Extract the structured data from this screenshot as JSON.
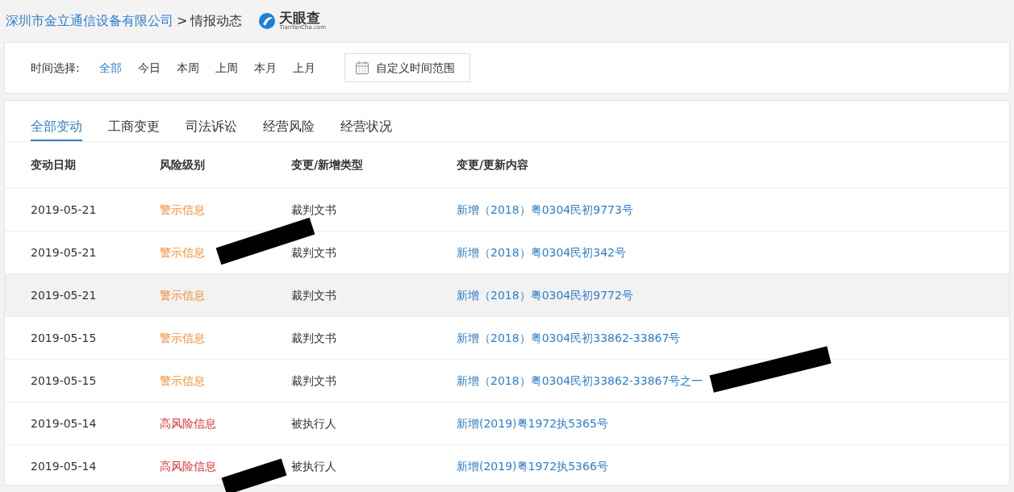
{
  "breadcrumb": {
    "company": "深圳市金立通信设备有限公司",
    "separator": ">",
    "page": "情报动态"
  },
  "logo": {
    "name": "天眼查",
    "domain": "TianYanCha.com"
  },
  "time_filter": {
    "label": "时间选择:",
    "options": [
      {
        "label": "全部",
        "selected": true
      },
      {
        "label": "今日",
        "selected": false
      },
      {
        "label": "本周",
        "selected": false
      },
      {
        "label": "上周",
        "selected": false
      },
      {
        "label": "本月",
        "selected": false
      },
      {
        "label": "上月",
        "selected": false
      }
    ],
    "custom_button": "自定义时间范围"
  },
  "tabs": [
    {
      "label": "全部变动",
      "selected": true
    },
    {
      "label": "工商变更",
      "selected": false
    },
    {
      "label": "司法诉讼",
      "selected": false
    },
    {
      "label": "经营风险",
      "selected": false
    },
    {
      "label": "经营状况",
      "selected": false
    }
  ],
  "table": {
    "columns": [
      "变动日期",
      "风险级别",
      "变更/新增类型",
      "变更/更新内容"
    ],
    "rows": [
      {
        "date": "2019-05-21",
        "risk": "警示信息",
        "kind": "warning",
        "type": "裁判文书",
        "content": "新增（2018）粤0304民初9773号",
        "highlighted": false
      },
      {
        "date": "2019-05-21",
        "risk": "警示信息",
        "kind": "warning",
        "type": "裁判文书",
        "content": "新增（2018）粤0304民初342号",
        "highlighted": false
      },
      {
        "date": "2019-05-21",
        "risk": "警示信息",
        "kind": "warning",
        "type": "裁判文书",
        "content": "新增（2018）粤0304民初9772号",
        "highlighted": true
      },
      {
        "date": "2019-05-15",
        "risk": "警示信息",
        "kind": "warning",
        "type": "裁判文书",
        "content": "新增（2018）粤0304民初33862-33867号",
        "highlighted": false
      },
      {
        "date": "2019-05-15",
        "risk": "警示信息",
        "kind": "warning",
        "type": "裁判文书",
        "content": "新增（2018）粤0304民初33862-33867号之一",
        "highlighted": false
      },
      {
        "date": "2019-05-14",
        "risk": "高风险信息",
        "kind": "high",
        "type": "被执行人",
        "content": "新增(2019)粤1972执5365号",
        "highlighted": false
      },
      {
        "date": "2019-05-14",
        "risk": "高风险信息",
        "kind": "high",
        "type": "被执行人",
        "content": "新增(2019)粤1972执5366号",
        "highlighted": false
      }
    ]
  }
}
